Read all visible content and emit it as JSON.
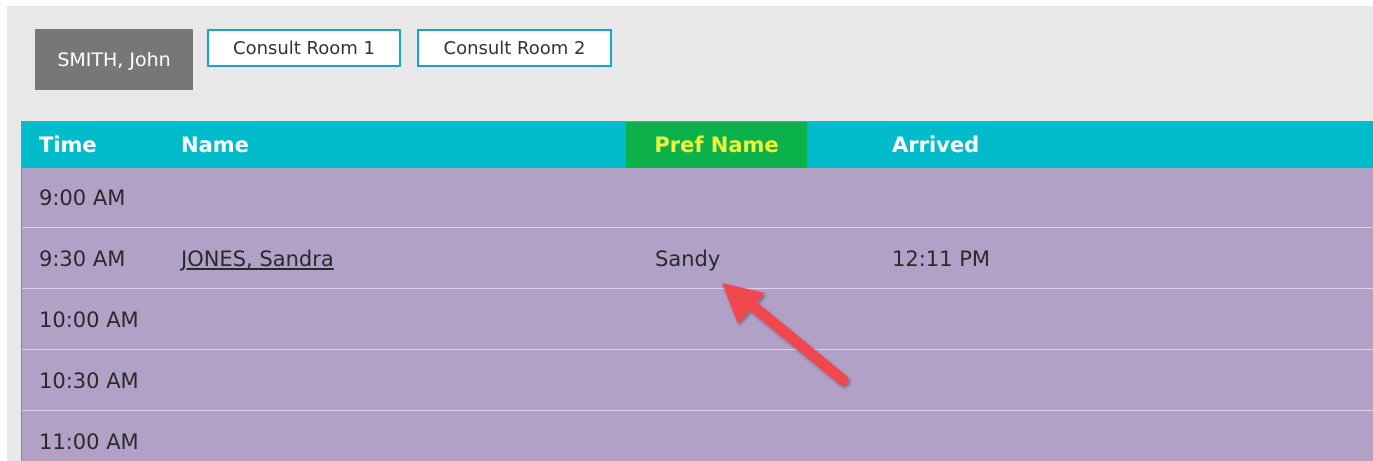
{
  "tabs": {
    "active_label": "SMITH, John",
    "rooms": [
      {
        "label": "Consult Room 1"
      },
      {
        "label": "Consult Room 2"
      }
    ]
  },
  "table": {
    "columns": {
      "time": "Time",
      "name": "Name",
      "pref_name": "Pref Name",
      "arrived": "Arrived"
    },
    "rows": [
      {
        "time": "9:00 AM",
        "name": "",
        "pref_name": "",
        "arrived": ""
      },
      {
        "time": "9:30 AM",
        "name": "JONES, Sandra",
        "pref_name": "Sandy",
        "arrived": "12:11 PM"
      },
      {
        "time": "10:00 AM",
        "name": "",
        "pref_name": "",
        "arrived": ""
      },
      {
        "time": "10:30 AM",
        "name": "",
        "pref_name": "",
        "arrived": ""
      },
      {
        "time": "11:00 AM",
        "name": "",
        "pref_name": "",
        "arrived": ""
      }
    ]
  },
  "colors": {
    "header_bg": "#00bccb",
    "pref_header_bg": "#0bb24b",
    "pref_header_text": "#f2f23a",
    "row_bg": "#b2a1c7",
    "tab_active_bg": "#777777",
    "tab_border": "#1aa3c8",
    "annotation_arrow": "#f0474f"
  },
  "annotation": {
    "icon": "red-arrow-icon"
  }
}
